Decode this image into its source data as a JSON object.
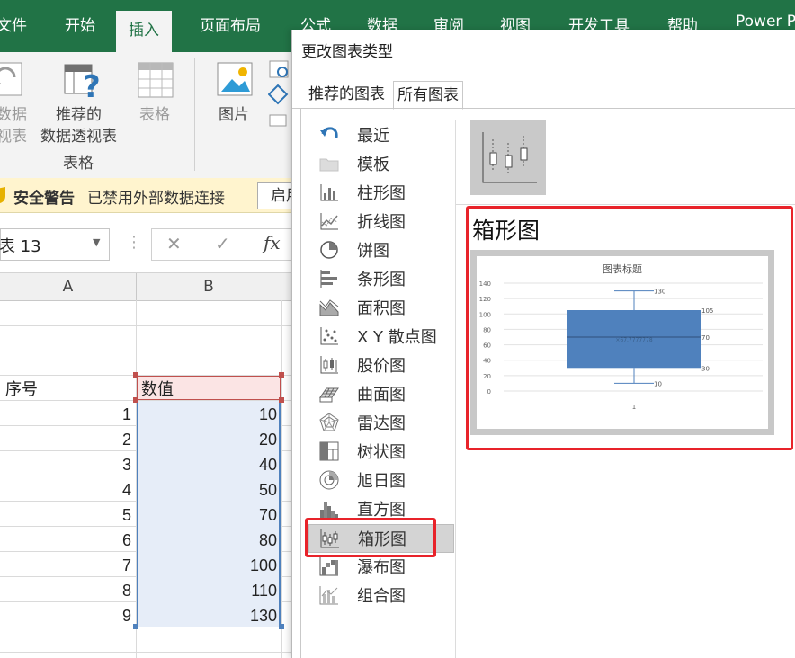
{
  "ribbon": {
    "tabs": [
      "文件",
      "开始",
      "插入",
      "页面布局",
      "公式",
      "数据",
      "审阅",
      "视图",
      "开发工具",
      "帮助",
      "Power Pivot"
    ],
    "active_tab": "插入",
    "pivot_label_1": "数据",
    "pivot_label_2": "视表",
    "recommended_pivot_1": "推荐的",
    "recommended_pivot_2": "数据透视表",
    "table_label": "表格",
    "group_label": "表格",
    "picture_label": "图片"
  },
  "warning": {
    "title": "安全警告",
    "message": "已禁用外部数据连接",
    "button": "启用"
  },
  "formula_bar": {
    "name_box": "表 13",
    "cancel": "✕",
    "confirm": "✓",
    "fx": "fx"
  },
  "sheet": {
    "columns": [
      "A",
      "B"
    ],
    "header_a": "序号",
    "header_b": "数值",
    "rows": [
      {
        "a": "1",
        "b": "10"
      },
      {
        "a": "2",
        "b": "20"
      },
      {
        "a": "3",
        "b": "40"
      },
      {
        "a": "4",
        "b": "50"
      },
      {
        "a": "5",
        "b": "70"
      },
      {
        "a": "6",
        "b": "80"
      },
      {
        "a": "7",
        "b": "100"
      },
      {
        "a": "8",
        "b": "110"
      },
      {
        "a": "9",
        "b": "130"
      }
    ]
  },
  "dialog": {
    "title": "更改图表类型",
    "tabs": [
      "推荐的图表",
      "所有图表"
    ],
    "active_tab": "所有图表",
    "nav": [
      {
        "label": "最近",
        "icon": "undo-arrow-icon"
      },
      {
        "label": "模板",
        "icon": "folder-icon"
      },
      {
        "label": "柱形图",
        "icon": "column-chart-icon"
      },
      {
        "label": "折线图",
        "icon": "line-chart-icon"
      },
      {
        "label": "饼图",
        "icon": "pie-chart-icon"
      },
      {
        "label": "条形图",
        "icon": "bar-chart-icon"
      },
      {
        "label": "面积图",
        "icon": "area-chart-icon"
      },
      {
        "label": "X Y 散点图",
        "icon": "scatter-chart-icon"
      },
      {
        "label": "股价图",
        "icon": "stock-chart-icon"
      },
      {
        "label": "曲面图",
        "icon": "surface-chart-icon"
      },
      {
        "label": "雷达图",
        "icon": "radar-chart-icon"
      },
      {
        "label": "树状图",
        "icon": "treemap-chart-icon"
      },
      {
        "label": "旭日图",
        "icon": "sunburst-chart-icon"
      },
      {
        "label": "直方图",
        "icon": "histogram-chart-icon"
      },
      {
        "label": "箱形图",
        "icon": "box-whisker-chart-icon"
      },
      {
        "label": "瀑布图",
        "icon": "waterfall-chart-icon"
      },
      {
        "label": "组合图",
        "icon": "combo-chart-icon"
      }
    ],
    "selected_nav": "箱形图",
    "preview_heading": "箱形图"
  },
  "chart_data": {
    "type": "box",
    "title": "图表标题",
    "categories": [
      "1"
    ],
    "yticks": [
      "0",
      "20",
      "40",
      "60",
      "80",
      "100",
      "120",
      "140"
    ],
    "ylim": [
      0,
      140
    ],
    "box": {
      "min": 10,
      "q1": 30,
      "median": 70,
      "q3": 105,
      "max": 130,
      "mean": 67.7777778
    },
    "labels": {
      "max": "130",
      "q3": "105",
      "median": "70",
      "q1": "30",
      "min": "10",
      "mean": "67.7777778"
    },
    "grid": true,
    "colors": {
      "box": "#4f81bd"
    }
  },
  "colors": {
    "ribbon_green": "#217346",
    "highlight_red": "#e8232a",
    "table_fill": "#e6edf8",
    "header_fill": "#fbe4e4"
  }
}
